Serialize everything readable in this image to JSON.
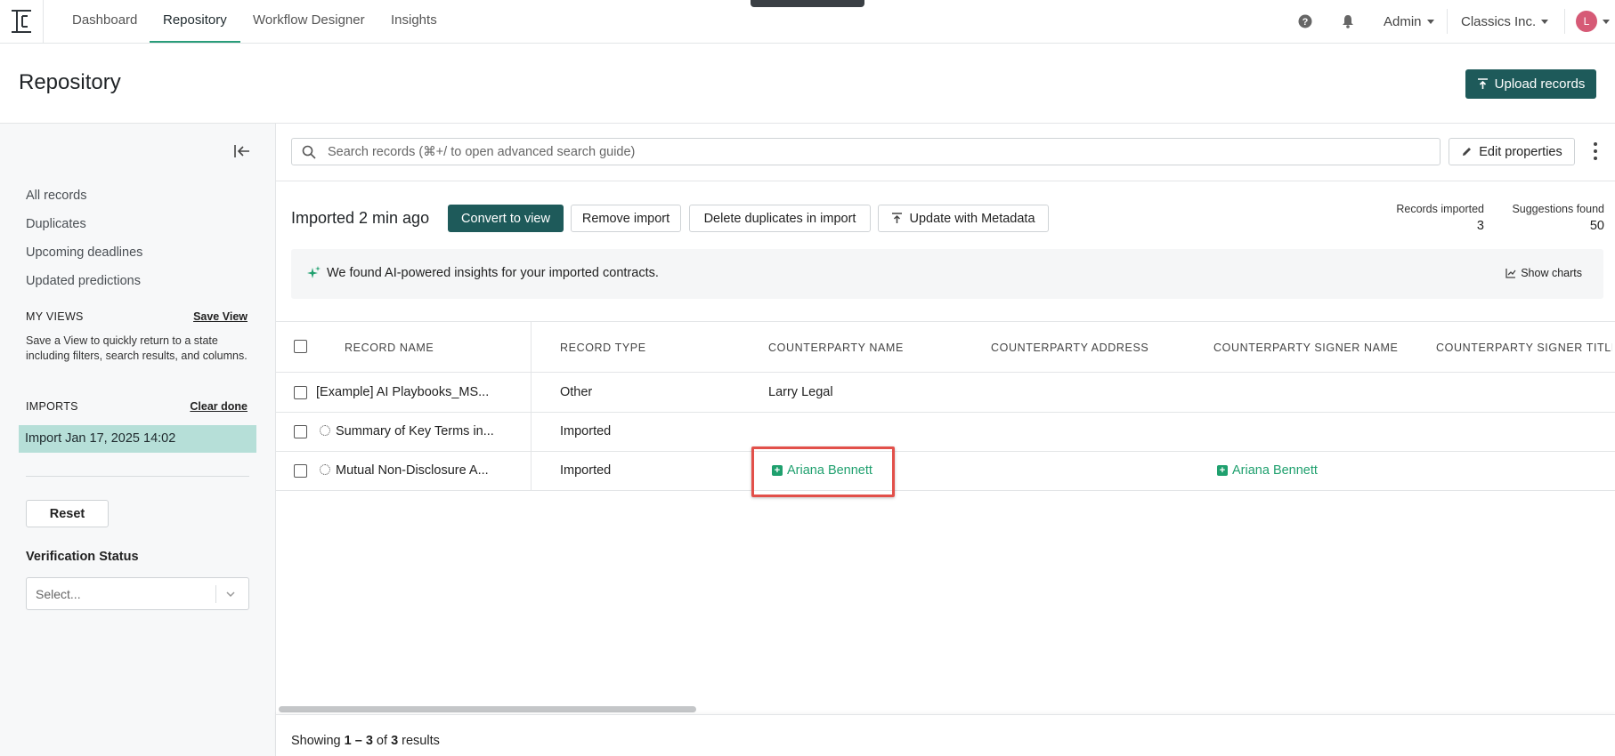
{
  "nav": {
    "tabs": [
      {
        "label": "Dashboard"
      },
      {
        "label": "Repository"
      },
      {
        "label": "Workflow Designer"
      },
      {
        "label": "Insights"
      }
    ],
    "active_tab": "Repository",
    "user_menu": "Admin",
    "org_menu": "Classics Inc.",
    "avatar_initial": "L"
  },
  "header": {
    "title": "Repository",
    "upload_label": "Upload records"
  },
  "sidebar": {
    "links": [
      "All records",
      "Duplicates",
      "Upcoming deadlines",
      "Updated predictions"
    ],
    "my_views": {
      "heading": "MY VIEWS",
      "action": "Save View",
      "note": "Save a View to quickly return to a state including filters, search results, and columns."
    },
    "imports": {
      "heading": "IMPORTS",
      "action": "Clear done",
      "items": [
        "Import Jan 17, 2025 14:02"
      ]
    },
    "reset_label": "Reset",
    "filter": {
      "label": "Verification Status",
      "placeholder": "Select..."
    }
  },
  "toolbar": {
    "search_placeholder": "Search records (⌘+/ to open advanced search guide)",
    "edit_properties_label": "Edit properties"
  },
  "import_panel": {
    "title": "Imported 2 min ago",
    "buttons": {
      "convert": "Convert to view",
      "remove": "Remove import",
      "delete_dupes": "Delete duplicates in import",
      "update_meta": "Update with Metadata"
    },
    "stats": {
      "imported_label": "Records imported",
      "imported_value": "3",
      "suggestions_label": "Suggestions found",
      "suggestions_value": "50"
    },
    "insight_text": "We found AI-powered insights for your imported contracts.",
    "show_charts": "Show charts"
  },
  "table": {
    "columns": [
      "RECORD NAME",
      "RECORD TYPE",
      "COUNTERPARTY NAME",
      "COUNTERPARTY ADDRESS",
      "COUNTERPARTY SIGNER NAME",
      "COUNTERPARTY SIGNER TITLE"
    ],
    "rows": [
      {
        "name": "[Example] AI Playbooks_MS...",
        "type": "Other",
        "counterparty": "Larry Legal",
        "signer": "",
        "processing": false,
        "suggested": false
      },
      {
        "name": "Summary of Key Terms in...",
        "type": "Imported",
        "counterparty": "",
        "signer": "",
        "processing": true,
        "suggested": false
      },
      {
        "name": "Mutual Non-Disclosure A...",
        "type": "Imported",
        "counterparty": "Ariana Bennett",
        "signer": "Ariana Bennett",
        "processing": true,
        "suggested": true
      }
    ]
  },
  "footer": {
    "prefix": "Showing ",
    "range": "1 – 3",
    "middle": " of ",
    "total": "3",
    "suffix": " results"
  },
  "colors": {
    "primary": "#1e5a5a",
    "accent_green": "#1fa06e",
    "highlight_red": "#e2504a",
    "import_selected": "#b6dfd8"
  }
}
